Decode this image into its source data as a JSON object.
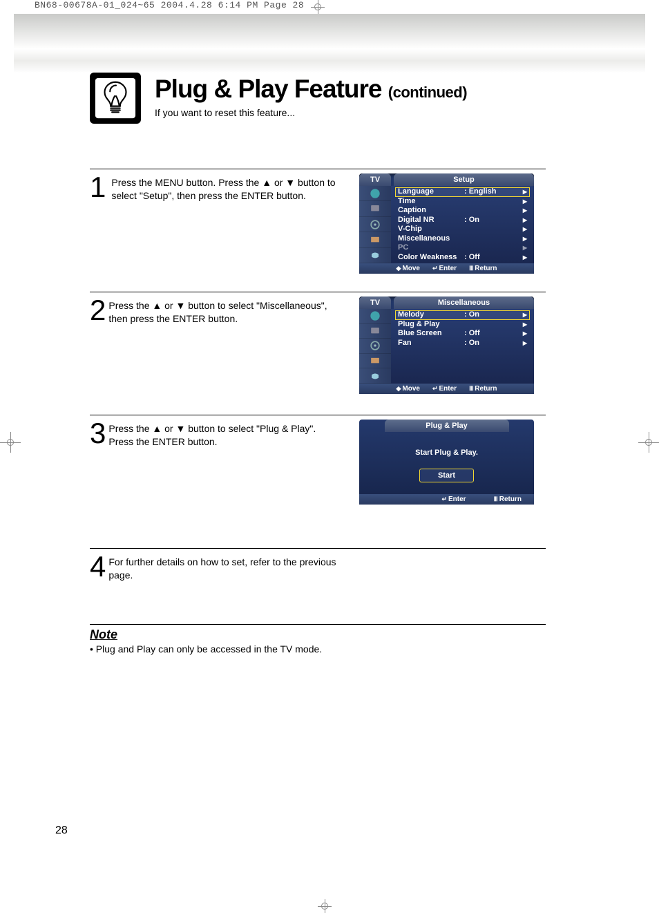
{
  "crop_header": "BN68-00678A-01_024~65  2004.4.28  6:14 PM  Page 28",
  "title_main": "Plug & Play Feature",
  "title_cont": "(continued)",
  "subtitle": "If you want to reset this feature...",
  "steps": [
    {
      "num": "1",
      "text": "Press the MENU button. Press the ▲ or ▼ button to select \"Setup\", then press the ENTER button."
    },
    {
      "num": "2",
      "text": "Press the ▲ or ▼ button to select \"Miscellaneous\", then press the ENTER button."
    },
    {
      "num": "3",
      "text": "Press the ▲ or ▼ button to select \"Plug & Play\". Press the ENTER button."
    },
    {
      "num": "4",
      "text": "For further details on how to set, refer to the previous page."
    }
  ],
  "osd1": {
    "tab_tv": "TV",
    "tab_title": "Setup",
    "items": [
      {
        "label": "Language",
        "value": ":  English",
        "selected": true
      },
      {
        "label": "Time",
        "value": ""
      },
      {
        "label": "Caption",
        "value": ""
      },
      {
        "label": "Digital NR",
        "value": ":  On"
      },
      {
        "label": "V-Chip",
        "value": ""
      },
      {
        "label": "Miscellaneous",
        "value": ""
      },
      {
        "label": "PC",
        "value": "",
        "dim": true
      },
      {
        "label": "Color Weakness",
        "value": ":  Off"
      }
    ],
    "footer": {
      "move": "Move",
      "enter": "Enter",
      "return": "Return"
    }
  },
  "osd2": {
    "tab_tv": "TV",
    "tab_title": "Miscellaneous",
    "items": [
      {
        "label": "Melody",
        "value": ":  On",
        "selected": true
      },
      {
        "label": "Plug & Play",
        "value": ""
      },
      {
        "label": "Blue Screen",
        "value": ":  Off"
      },
      {
        "label": "Fan",
        "value": ":  On"
      }
    ],
    "footer": {
      "move": "Move",
      "enter": "Enter",
      "return": "Return"
    }
  },
  "osd3": {
    "title": "Plug & Play",
    "message": "Start Plug & Play.",
    "button": "Start",
    "footer": {
      "enter": "Enter",
      "return": "Return"
    }
  },
  "note_heading": "Note",
  "note_bullet": "•  Plug and Play can only be accessed in the TV mode.",
  "page_number": "28"
}
